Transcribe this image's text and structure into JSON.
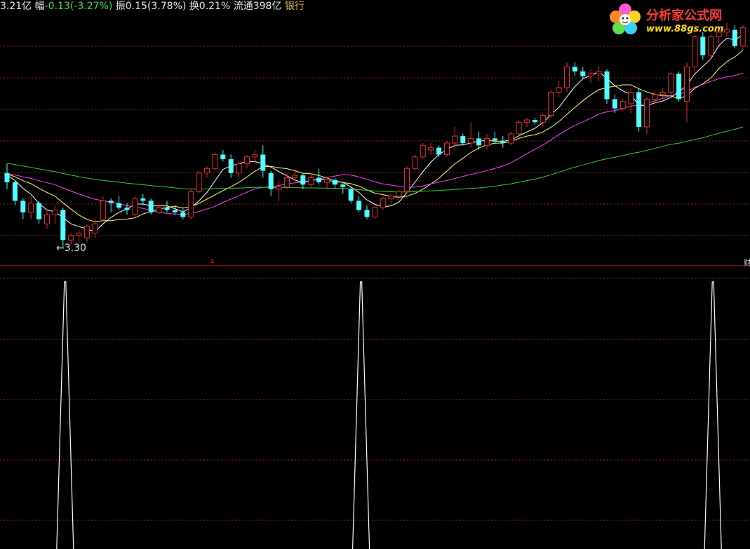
{
  "header": {
    "amount": "3.21亿",
    "change_label": "幅",
    "change_value": "-0.13(-3.27%)",
    "amplitude_label": "振",
    "amplitude_value": "0.15(3.78%)",
    "turnover_label": "换",
    "turnover_value": "0.21%",
    "float_label": "流通",
    "float_value": "398亿",
    "sector": "银行"
  },
  "watermark": {
    "title": "分析家公式网",
    "url": "www.88gs.com"
  },
  "price_panel": {
    "low_label": "3.30",
    "signal_mark": "s",
    "right_mark": "财"
  },
  "colors": {
    "up": "#e03030",
    "down": "#54ffff",
    "ma5": "#ffffff",
    "ma10": "#ffff60",
    "ma20": "#ff40ff",
    "ma60": "#30d030",
    "grid": "#a01818",
    "divider": "#c81818",
    "signal": "#ffffff"
  },
  "chart_data": [
    {
      "type": "candlestick",
      "series": [
        {
          "name": "price",
          "ohlc": [
            [
              3.62,
              3.66,
              3.55,
              3.58
            ],
            [
              3.58,
              3.59,
              3.48,
              3.5
            ],
            [
              3.5,
              3.51,
              3.42,
              3.45
            ],
            [
              3.45,
              3.52,
              3.42,
              3.49
            ],
            [
              3.49,
              3.5,
              3.4,
              3.42
            ],
            [
              3.4,
              3.46,
              3.38,
              3.44
            ],
            [
              3.44,
              3.48,
              3.4,
              3.46
            ],
            [
              3.46,
              3.47,
              3.3,
              3.33
            ],
            [
              3.33,
              3.36,
              3.31,
              3.35
            ],
            [
              3.35,
              3.37,
              3.32,
              3.36
            ],
            [
              3.34,
              3.4,
              3.32,
              3.39
            ],
            [
              3.36,
              3.42,
              3.34,
              3.4
            ],
            [
              3.42,
              3.52,
              3.41,
              3.5
            ],
            [
              3.5,
              3.51,
              3.45,
              3.49
            ],
            [
              3.49,
              3.52,
              3.46,
              3.47
            ],
            [
              3.47,
              3.49,
              3.44,
              3.46
            ],
            [
              3.44,
              3.52,
              3.43,
              3.51
            ],
            [
              3.51,
              3.53,
              3.48,
              3.5
            ],
            [
              3.5,
              3.51,
              3.44,
              3.45
            ],
            [
              3.45,
              3.48,
              3.44,
              3.47
            ],
            [
              3.47,
              3.5,
              3.45,
              3.46
            ],
            [
              3.46,
              3.48,
              3.44,
              3.45
            ],
            [
              3.45,
              3.47,
              3.42,
              3.43
            ],
            [
              3.43,
              3.55,
              3.42,
              3.54
            ],
            [
              3.54,
              3.63,
              3.53,
              3.62
            ],
            [
              3.62,
              3.65,
              3.6,
              3.64
            ],
            [
              3.64,
              3.71,
              3.63,
              3.7
            ],
            [
              3.7,
              3.72,
              3.67,
              3.68
            ],
            [
              3.68,
              3.7,
              3.6,
              3.62
            ],
            [
              3.62,
              3.67,
              3.6,
              3.66
            ],
            [
              3.66,
              3.7,
              3.64,
              3.69
            ],
            [
              3.69,
              3.72,
              3.66,
              3.7
            ],
            [
              3.7,
              3.74,
              3.6,
              3.63
            ],
            [
              3.62,
              3.63,
              3.52,
              3.55
            ],
            [
              3.55,
              3.58,
              3.5,
              3.56
            ],
            [
              3.56,
              3.62,
              3.55,
              3.6
            ],
            [
              3.6,
              3.63,
              3.58,
              3.61
            ],
            [
              3.61,
              3.62,
              3.55,
              3.57
            ],
            [
              3.57,
              3.62,
              3.56,
              3.6
            ],
            [
              3.6,
              3.64,
              3.57,
              3.58
            ],
            [
              3.58,
              3.6,
              3.55,
              3.59
            ],
            [
              3.59,
              3.6,
              3.55,
              3.57
            ],
            [
              3.57,
              3.58,
              3.53,
              3.56
            ],
            [
              3.55,
              3.56,
              3.49,
              3.5
            ],
            [
              3.5,
              3.52,
              3.45,
              3.46
            ],
            [
              3.46,
              3.48,
              3.42,
              3.43
            ],
            [
              3.43,
              3.48,
              3.42,
              3.47
            ],
            [
              3.47,
              3.52,
              3.46,
              3.51
            ],
            [
              3.51,
              3.53,
              3.49,
              3.52
            ],
            [
              3.52,
              3.55,
              3.5,
              3.54
            ],
            [
              3.54,
              3.65,
              3.53,
              3.64
            ],
            [
              3.64,
              3.7,
              3.63,
              3.69
            ],
            [
              3.69,
              3.75,
              3.68,
              3.74
            ],
            [
              3.72,
              3.75,
              3.7,
              3.73
            ],
            [
              3.73,
              3.74,
              3.69,
              3.7
            ],
            [
              3.7,
              3.76,
              3.69,
              3.75
            ],
            [
              3.75,
              3.82,
              3.72,
              3.78
            ],
            [
              3.78,
              3.79,
              3.74,
              3.75
            ],
            [
              3.75,
              3.84,
              3.73,
              3.77
            ],
            [
              3.77,
              3.8,
              3.72,
              3.74
            ],
            [
              3.74,
              3.79,
              3.72,
              3.77
            ],
            [
              3.77,
              3.8,
              3.75,
              3.76
            ],
            [
              3.76,
              3.78,
              3.73,
              3.75
            ],
            [
              3.75,
              3.8,
              3.74,
              3.79
            ],
            [
              3.79,
              3.85,
              3.78,
              3.84
            ],
            [
              3.84,
              3.86,
              3.82,
              3.85
            ],
            [
              3.85,
              3.86,
              3.83,
              3.84
            ],
            [
              3.84,
              3.88,
              3.82,
              3.87
            ],
            [
              3.87,
              3.98,
              3.86,
              3.97
            ],
            [
              3.97,
              4.02,
              3.95,
              3.99
            ],
            [
              3.99,
              4.1,
              3.97,
              4.08
            ],
            [
              4.08,
              4.1,
              4.04,
              4.06
            ],
            [
              4.06,
              4.08,
              4.03,
              4.04
            ],
            [
              4.04,
              4.07,
              4.01,
              4.05
            ],
            [
              4.05,
              4.08,
              4.02,
              4.06
            ],
            [
              4.06,
              4.07,
              3.92,
              3.94
            ],
            [
              3.94,
              3.96,
              3.88,
              3.9
            ],
            [
              3.9,
              3.94,
              3.89,
              3.93
            ],
            [
              3.92,
              3.99,
              3.88,
              3.97
            ],
            [
              3.97,
              3.99,
              3.8,
              3.82
            ],
            [
              3.82,
              3.95,
              3.79,
              3.94
            ],
            [
              3.94,
              3.98,
              3.92,
              3.96
            ],
            [
              3.96,
              3.99,
              3.94,
              3.97
            ],
            [
              3.97,
              4.06,
              3.96,
              4.05
            ],
            [
              4.05,
              4.06,
              3.93,
              3.94
            ],
            [
              3.93,
              4.1,
              3.84,
              4.08
            ],
            [
              4.08,
              4.22,
              4.06,
              4.21
            ],
            [
              4.21,
              4.23,
              4.11,
              4.13
            ],
            [
              4.13,
              4.22,
              4.11,
              4.21
            ],
            [
              4.21,
              4.24,
              4.18,
              4.23
            ],
            [
              4.23,
              4.27,
              4.21,
              4.24
            ],
            [
              4.24,
              4.26,
              4.16,
              4.17
            ],
            [
              4.17,
              4.26,
              4.15,
              4.25
            ]
          ]
        },
        {
          "name": "MA5"
        },
        {
          "name": "MA10"
        },
        {
          "name": "MA20"
        },
        {
          "name": "MA60"
        }
      ],
      "ylim": [
        3.24,
        4.26
      ]
    },
    {
      "type": "line",
      "series": [
        {
          "name": "signal",
          "peaks": [
            7,
            44,
            88
          ]
        }
      ]
    }
  ]
}
